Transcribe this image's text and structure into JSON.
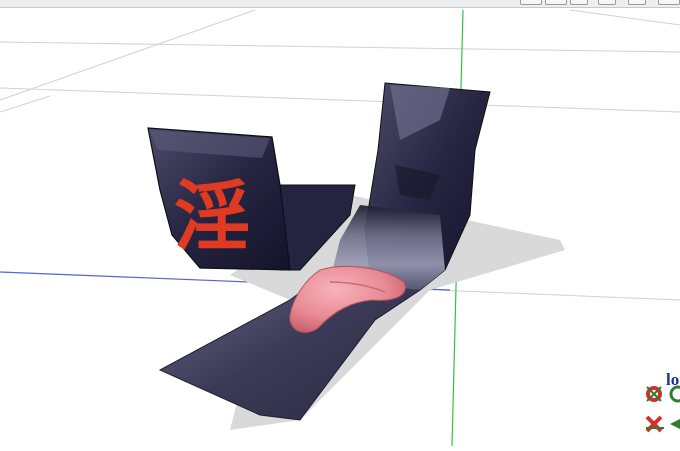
{
  "overlay": {
    "label": "lo"
  },
  "toolbar": {
    "icons": [
      "toolbar-button",
      "toolbar-button",
      "toolbar-button",
      "toolbar-button",
      "toolbar-button",
      "toolbar-button"
    ]
  },
  "model": {
    "emblem_text": "淫"
  },
  "colors": {
    "grid": "#d2d2d2",
    "axis_green": "#35c13a",
    "axis_red": "#e0524a",
    "axis_blue": "#5566d6",
    "fabric_dark": "#2a2946",
    "fabric_light": "#7b7a95",
    "emblem": "#e03a22",
    "tongue": "#e98b95",
    "shadow": "#d9d9d9",
    "label": "#1f2f9c"
  }
}
